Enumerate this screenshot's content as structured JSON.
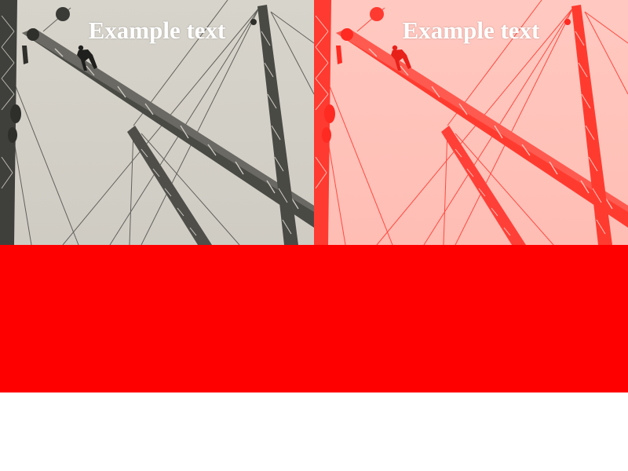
{
  "panels": [
    {
      "caption": "Example text",
      "tint": "none"
    },
    {
      "caption": "Example text",
      "tint": "red"
    }
  ],
  "colors": {
    "band": "#ff0000",
    "background": "#ffffff",
    "caption": "#ffffff",
    "photo_sky": "#d9d7cf",
    "photo_steel": "#4b4b47",
    "tint": "#ff3b3b"
  }
}
